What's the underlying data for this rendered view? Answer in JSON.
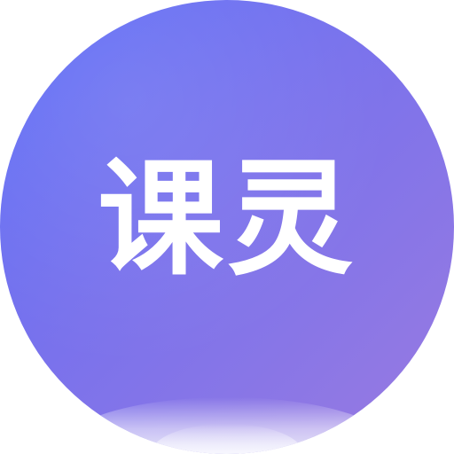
{
  "icon": {
    "brand_text": "课灵",
    "shape": "circle",
    "gradient_colors": [
      "#5a6cf7",
      "#7a72ec",
      "#9a7be0"
    ],
    "text_color": "#ffffff"
  }
}
